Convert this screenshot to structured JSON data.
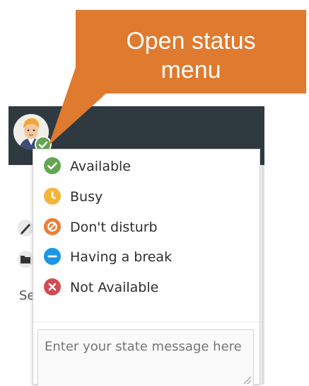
{
  "callout": {
    "line1": "Open status",
    "line2": "menu"
  },
  "background": {
    "partial_text": "Se"
  },
  "status_menu": {
    "items": [
      {
        "label": "Available",
        "icon": "check-circle-icon",
        "color": "#64a552"
      },
      {
        "label": "Busy",
        "icon": "clock-icon",
        "color": "#f4b43a"
      },
      {
        "label": "Don't disturb",
        "icon": "do-not-disturb-icon",
        "color": "#ee7d35"
      },
      {
        "label": "Having a break",
        "icon": "minus-circle-icon",
        "color": "#1b97e8"
      },
      {
        "label": "Not Available",
        "icon": "x-circle-icon",
        "color": "#d14b52"
      }
    ],
    "message_placeholder": "Enter your state message here"
  },
  "colors": {
    "callout": "#df7a2e",
    "topbar": "#2f3a40"
  }
}
